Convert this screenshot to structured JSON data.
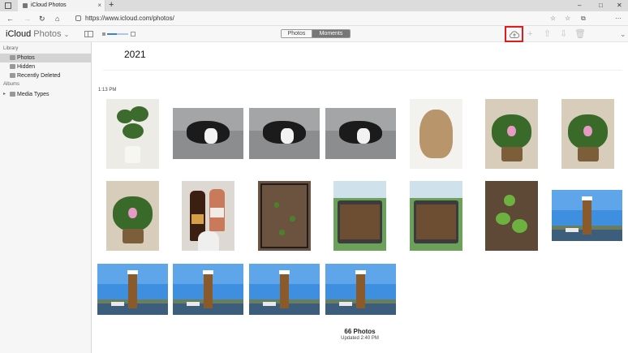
{
  "browser": {
    "tab_title": "iCloud Photos",
    "tab_close": "×",
    "new_tab": "+",
    "url": "https://www.icloud.com/photos/",
    "controls": {
      "minimize": "–",
      "maximize": "□",
      "close": "✕"
    },
    "nav": {
      "back": "←",
      "forward": "→",
      "reload": "↻",
      "home": "⌂"
    },
    "toolbar_icons": [
      "☆",
      "☆",
      "⧉",
      "⋯"
    ]
  },
  "app": {
    "brand_main": "iCloud",
    "brand_sub": "Photos",
    "brand_chev": "⌄",
    "segments": {
      "photos": "Photos",
      "moments": "Moments"
    },
    "toolbar_icons": {
      "add": "+",
      "share": "⇧",
      "download": "⇩",
      "delete": "🗑",
      "more": "⌄"
    }
  },
  "sidebar": {
    "library_header": "Library",
    "library_items": [
      {
        "label": "Photos",
        "active": true
      },
      {
        "label": "Hidden",
        "active": false
      },
      {
        "label": "Recently Deleted",
        "active": false
      }
    ],
    "albums_header": "Albums",
    "album_items": [
      {
        "label": "Media Types",
        "expandable": true
      }
    ]
  },
  "main": {
    "year": "2021",
    "time_label": "1:13 PM",
    "count_label": "66 Photos",
    "updated_label": "Updated 2:40 PM",
    "photos": [
      {
        "kind": "plant"
      },
      {
        "kind": "dog"
      },
      {
        "kind": "dog"
      },
      {
        "kind": "dog"
      },
      {
        "kind": "frog"
      },
      {
        "kind": "violet"
      },
      {
        "kind": "violet"
      },
      {
        "kind": "violet"
      },
      {
        "kind": "bottles"
      },
      {
        "kind": "dirt"
      },
      {
        "kind": "planter"
      },
      {
        "kind": "planter"
      },
      {
        "kind": "sprout"
      },
      {
        "kind": "sky"
      },
      {
        "kind": "sky"
      },
      {
        "kind": "sky"
      },
      {
        "kind": "sky"
      },
      {
        "kind": "sky"
      }
    ]
  },
  "colors": {
    "highlight": "#e21b1b",
    "segment_active": "#777777",
    "slider": "#3b82d6"
  }
}
